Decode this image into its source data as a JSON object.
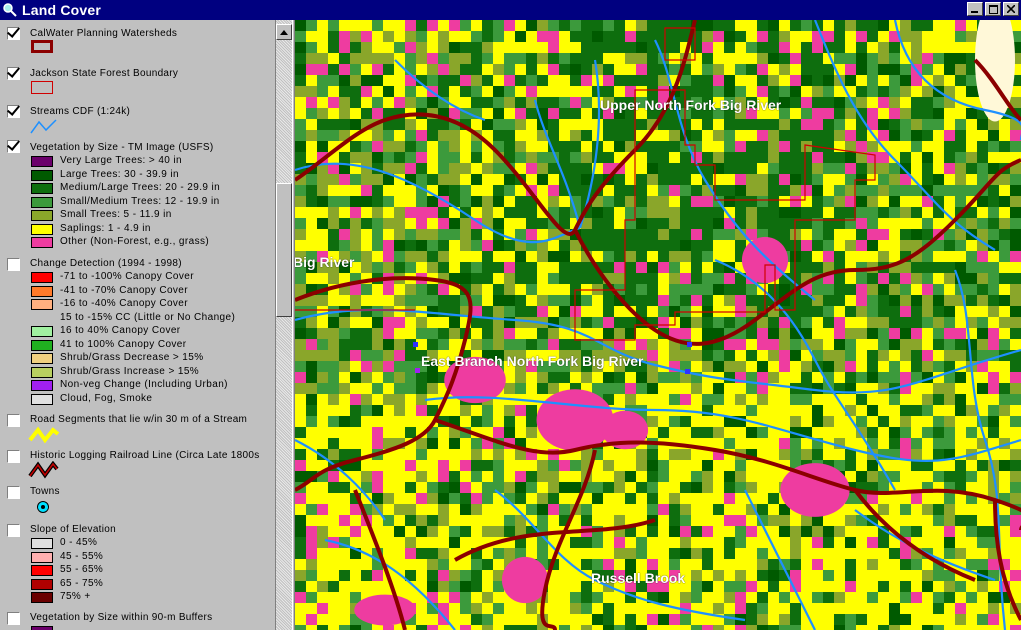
{
  "window": {
    "title": "Land Cover",
    "icon": "magnifier-icon"
  },
  "legend": {
    "layers": [
      {
        "title": "CalWater Planning Watersheds",
        "checked": true,
        "symbol": "dark-red-outline-box"
      },
      {
        "title": "Jackson State Forest Boundary",
        "checked": true,
        "symbol": "red-outline-box"
      },
      {
        "title": "Streams CDF (1:24k)",
        "checked": true,
        "symbol": "blue-line"
      },
      {
        "title": "Vegetation by Size - TM Image (USFS)",
        "checked": true,
        "classes": [
          {
            "label": "Very Large Trees: > 40  in",
            "color": "#6b006b"
          },
          {
            "label": "Large Trees: 30 - 39.9 in",
            "color": "#005a00"
          },
          {
            "label": "Medium/Large Trees: 20 - 29.9 in",
            "color": "#0e6e0e"
          },
          {
            "label": "Small/Medium Trees: 12 - 19.9 in",
            "color": "#3c9a3c"
          },
          {
            "label": "Small Trees: 5 - 11.9 in",
            "color": "#8aa62a"
          },
          {
            "label": "Saplings: 1 - 4.9 in",
            "color": "#ffff00"
          },
          {
            "label": "Other (Non-Forest, e.g., grass)",
            "color": "#ee3ca0"
          }
        ]
      },
      {
        "title": "Change Detection (1994 - 1998)",
        "checked": false,
        "classes": [
          {
            "label": "-71 to -100% Canopy Cover",
            "color": "#ff0000"
          },
          {
            "label": "-41 to -70% Canopy Cover",
            "color": "#ff7a2a"
          },
          {
            "label": "-16 to -40% Canopy Cover",
            "color": "#ffb080"
          },
          {
            "label": "15 to -15% CC (Little or No Change)",
            "color": ""
          },
          {
            "label": "16 to 40% Canopy Cover",
            "color": "#a0f0a0"
          },
          {
            "label": "41 to 100% Canopy Cover",
            "color": "#20b020"
          },
          {
            "label": "Shrub/Grass Decrease > 15%",
            "color": "#f0d080"
          },
          {
            "label": "Shrub/Grass Increase > 15%",
            "color": "#b8d060"
          },
          {
            "label": "Non-veg Change (Including Urban)",
            "color": "#a020f0"
          },
          {
            "label": "Cloud, Fog, Smoke",
            "color": "#e0e0e0"
          }
        ]
      },
      {
        "title": "Road Segments that lie w/in 30 m of a Stream",
        "checked": false,
        "symbol": "yellow-zigzag"
      },
      {
        "title": "Historic Logging Railroad Line (Circa Late 1800s",
        "checked": false,
        "symbol": "red-black-zigzag"
      },
      {
        "title": "Towns",
        "checked": false,
        "symbol": "cyan-dot"
      },
      {
        "title": "Slope of Elevation",
        "checked": false,
        "classes": [
          {
            "label": "0 - 45%",
            "color": "#e0e0e0"
          },
          {
            "label": "45 - 55%",
            "color": "#ffb0b0"
          },
          {
            "label": "55 - 65%",
            "color": "#ff0000"
          },
          {
            "label": "65 - 75%",
            "color": "#b00000"
          },
          {
            "label": "75% +",
            "color": "#6a0000"
          }
        ]
      },
      {
        "title": "Vegetation by Size within 90-m Buffers",
        "checked": false
      }
    ]
  },
  "map": {
    "labels": [
      {
        "text": "Upper North Fork Big River"
      },
      {
        "text": "Big River"
      },
      {
        "text": "East Branch North Fork Big River"
      },
      {
        "text": "Russell Brook"
      }
    ],
    "colors": {
      "watershed": "#8b0000",
      "boundary": "#d00000",
      "stream": "#1e90ff"
    }
  }
}
